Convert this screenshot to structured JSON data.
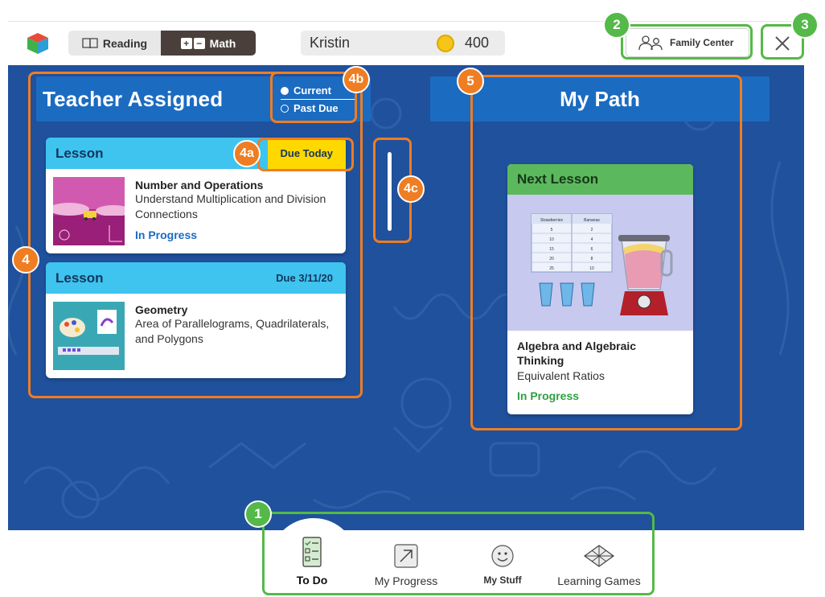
{
  "topbar": {
    "subjects": [
      {
        "label": "Reading",
        "icon": "book-icon",
        "active": false
      },
      {
        "label": "Math",
        "icon": "plus-minus-icon",
        "active": true
      }
    ],
    "user_name": "Kristin",
    "coins": "400",
    "family_center_label": "Family Center"
  },
  "teacher_assigned": {
    "title": "Teacher Assigned",
    "filters": [
      {
        "label": "Current",
        "selected": true
      },
      {
        "label": "Past Due",
        "selected": false
      }
    ],
    "cards": [
      {
        "type": "Lesson",
        "due": "Due Today",
        "due_highlight": true,
        "topic": "Number and Operations",
        "description": "Understand Multiplication and Division Connections",
        "status": "In Progress"
      },
      {
        "type": "Lesson",
        "due": "Due 3/11/20",
        "due_highlight": false,
        "topic": "Geometry",
        "description": "Area of Parallelograms, Quadrilaterals, and Polygons",
        "status": ""
      }
    ]
  },
  "my_path": {
    "title": "My Path",
    "card": {
      "header": "Next Lesson",
      "table_headers": [
        "Strawberries",
        "Bananas"
      ],
      "table_rows": [
        [
          "5",
          "2"
        ],
        [
          "10",
          "4"
        ],
        [
          "15",
          "6"
        ],
        [
          "20",
          "8"
        ],
        [
          "25",
          "10"
        ]
      ],
      "topic": "Algebra and Algebraic Thinking",
      "description": "Equivalent Ratios",
      "status": "In Progress"
    }
  },
  "bottom_nav": [
    {
      "label": "To Do",
      "icon": "checklist-icon",
      "active": true
    },
    {
      "label": "My Progress",
      "icon": "arrow-up-right-icon",
      "active": false
    },
    {
      "label": "My Stuff",
      "icon": "smiley-icon",
      "active": false
    },
    {
      "label": "Learning Games",
      "icon": "geometric-shapes-icon",
      "active": false
    }
  ],
  "callouts": [
    "1",
    "2",
    "3",
    "4",
    "4a",
    "4b",
    "4c",
    "5"
  ],
  "colors": {
    "main_bg": "#20519c",
    "header_blue": "#1b6bc1",
    "card_head": "#3fc3ef",
    "due_today": "#ffd800",
    "next_lesson": "#5cb85c",
    "callout_orange": "#ef7d22",
    "callout_green": "#54b948"
  }
}
